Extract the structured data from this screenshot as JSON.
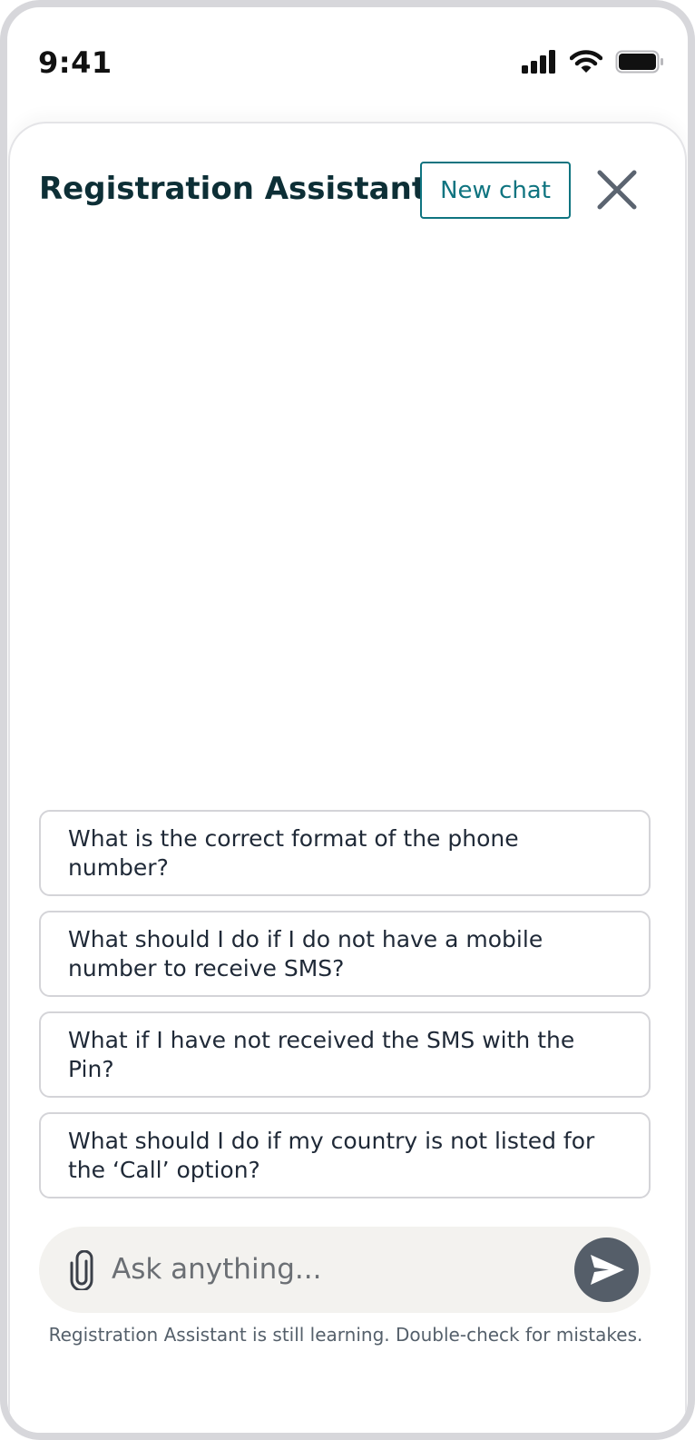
{
  "status_bar": {
    "time": "9:41",
    "icons": [
      "cellular-signal-icon",
      "wifi-icon",
      "battery-icon"
    ]
  },
  "assistant": {
    "title": "Registration Assistant",
    "new_chat_label": "New chat",
    "close_icon": "close-icon"
  },
  "suggestions": [
    "What is the correct format of the phone number?",
    "What should I do if I do not have a mobile number to receive SMS?",
    "What if I have not received the SMS with the Pin?",
    "What should I do if my country is not listed for the ‘Call’ option?"
  ],
  "composer": {
    "placeholder": "Ask anything...",
    "value": "",
    "attach_icon": "paperclip-icon",
    "send_icon": "send-icon"
  },
  "disclaimer": "Registration Assistant is still learning. Double-check for mistakes.",
  "colors": {
    "title": "#0d2f36",
    "accent": "#0f7480",
    "send_button": "#555e69",
    "input_background": "#f3f2ef",
    "border": "#d4d4d8"
  }
}
